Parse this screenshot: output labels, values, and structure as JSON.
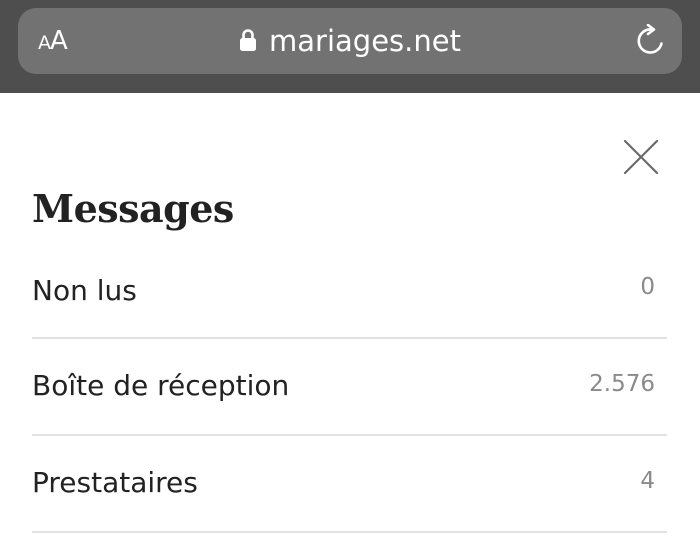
{
  "browser": {
    "text_size_small": "A",
    "text_size_large": "A",
    "url": "mariages.net",
    "lock_icon": "lock-icon",
    "reload_icon": "reload-icon",
    "bar_color": "#4e4e4e",
    "field_color": "#727272"
  },
  "panel": {
    "title": "Messages",
    "close_icon": "close-icon",
    "items": [
      {
        "label": "Non lus",
        "count": "0"
      },
      {
        "label": "Boîte de réception",
        "count": "2.576"
      },
      {
        "label": "Prestataires",
        "count": "4"
      }
    ]
  }
}
